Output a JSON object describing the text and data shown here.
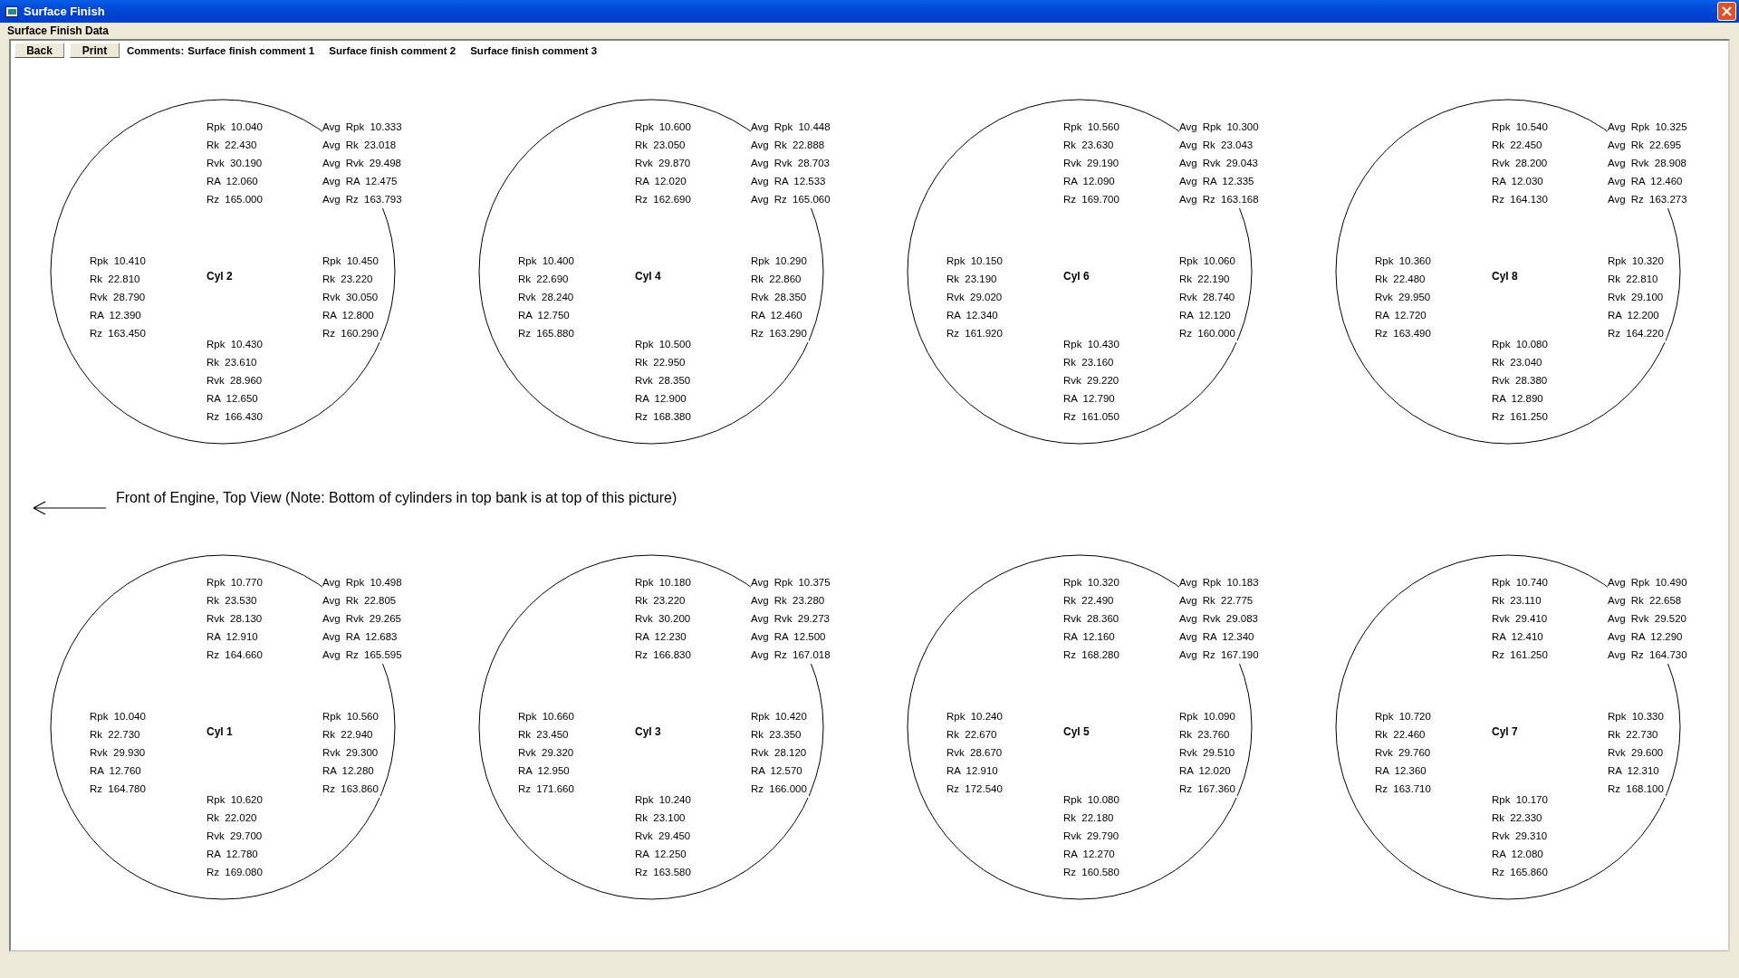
{
  "window": {
    "title": "Surface Finish"
  },
  "group_title": "Surface Finish Data",
  "buttons": [
    "Back",
    "Print"
  ],
  "comments_label": "Comments:",
  "comments": [
    "Surface finish comment 1",
    "Surface finish comment 2",
    "Surface finish comment 3"
  ],
  "note": "Front of Engine, Top View (Note: Bottom of cylinders in top bank is at top of this picture)",
  "top_bank": [
    {
      "label": "Cyl 2",
      "top": [
        "Rpk 10.040",
        "Rk 22.430",
        "Rvk 30.190",
        "RA 12.060",
        "Rz 165.000"
      ],
      "average": [
        "Avg Rpk 10.333",
        "Avg Rk 23.018",
        "Avg Rvk 29.498",
        "Avg RA 12.475",
        "Avg Rz 163.793"
      ],
      "left": [
        "Rpk 10.410",
        "Rk 22.810",
        "Rvk 28.790",
        "RA 12.390",
        "Rz 163.450"
      ],
      "right": [
        "Rpk 10.450",
        "Rk 23.220",
        "Rvk 30.050",
        "RA 12.800",
        "Rz 160.290"
      ],
      "bottom": [
        "Rpk 10.430",
        "Rk 23.610",
        "Rvk 28.960",
        "RA 12.650",
        "Rz 166.430"
      ]
    },
    {
      "label": "Cyl 4",
      "top": [
        "Rpk 10.600",
        "Rk 23.050",
        "Rvk 29.870",
        "RA 12.020",
        "Rz 162.690"
      ],
      "average": [
        "Avg Rpk 10.448",
        "Avg Rk 22.888",
        "Avg Rvk 28.703",
        "Avg RA 12.533",
        "Avg Rz 165.060"
      ],
      "left": [
        "Rpk 10.400",
        "Rk 22.690",
        "Rvk 28.240",
        "RA 12.750",
        "Rz 165.880"
      ],
      "right": [
        "Rpk 10.290",
        "Rk 22.860",
        "Rvk 28.350",
        "RA 12.460",
        "Rz 163.290"
      ],
      "bottom": [
        "Rpk 10.500",
        "Rk 22.950",
        "Rvk 28.350",
        "RA 12.900",
        "Rz 168.380"
      ]
    },
    {
      "label": "Cyl 6",
      "top": [
        "Rpk 10.560",
        "Rk 23.630",
        "Rvk 29.190",
        "RA 12.090",
        "Rz 169.700"
      ],
      "average": [
        "Avg Rpk 10.300",
        "Avg Rk 23.043",
        "Avg Rvk 29.043",
        "Avg RA 12.335",
        "Avg Rz 163.168"
      ],
      "left": [
        "Rpk 10.150",
        "Rk 23.190",
        "Rvk 29.020",
        "RA 12.340",
        "Rz 161.920"
      ],
      "right": [
        "Rpk 10.060",
        "Rk 22.190",
        "Rvk 28.740",
        "RA 12.120",
        "Rz 160.000"
      ],
      "bottom": [
        "Rpk 10.430",
        "Rk 23.160",
        "Rvk 29.220",
        "RA 12.790",
        "Rz 161.050"
      ]
    },
    {
      "label": "Cyl 8",
      "top": [
        "Rpk 10.540",
        "Rk 22.450",
        "Rvk 28.200",
        "RA 12.030",
        "Rz 164.130"
      ],
      "average": [
        "Avg Rpk 10.325",
        "Avg Rk 22.695",
        "Avg Rvk 28.908",
        "Avg RA 12.460",
        "Avg Rz 163.273"
      ],
      "left": [
        "Rpk 10.360",
        "Rk 22.480",
        "Rvk 29.950",
        "RA 12.720",
        "Rz 163.490"
      ],
      "right": [
        "Rpk 10.320",
        "Rk 22.810",
        "Rvk 29.100",
        "RA 12.200",
        "Rz 164.220"
      ],
      "bottom": [
        "Rpk 10.080",
        "Rk 23.040",
        "Rvk 28.380",
        "RA 12.890",
        "Rz 161.250"
      ]
    }
  ],
  "bottom_bank": [
    {
      "label": "Cyl 1",
      "top": [
        "Rpk 10.770",
        "Rk 23.530",
        "Rvk 28.130",
        "RA 12.910",
        "Rz 164.660"
      ],
      "average": [
        "Avg Rpk 10.498",
        "Avg Rk 22.805",
        "Avg Rvk 29.265",
        "Avg RA 12.683",
        "Avg Rz 165.595"
      ],
      "left": [
        "Rpk 10.040",
        "Rk 22.730",
        "Rvk 29.930",
        "RA 12.760",
        "Rz 164.780"
      ],
      "right": [
        "Rpk 10.560",
        "Rk 22.940",
        "Rvk 29.300",
        "RA 12.280",
        "Rz 163.860"
      ],
      "bottom": [
        "Rpk 10.620",
        "Rk 22.020",
        "Rvk 29.700",
        "RA 12.780",
        "Rz 169.080"
      ]
    },
    {
      "label": "Cyl 3",
      "top": [
        "Rpk 10.180",
        "Rk 23.220",
        "Rvk 30.200",
        "RA 12.230",
        "Rz 166.830"
      ],
      "average": [
        "Avg Rpk 10.375",
        "Avg Rk 23.280",
        "Avg Rvk 29.273",
        "Avg RA 12.500",
        "Avg Rz 167.018"
      ],
      "left": [
        "Rpk 10.660",
        "Rk 23.450",
        "Rvk 29.320",
        "RA 12.950",
        "Rz 171.660"
      ],
      "right": [
        "Rpk 10.420",
        "Rk 23.350",
        "Rvk 28.120",
        "RA 12.570",
        "Rz 166.000"
      ],
      "bottom": [
        "Rpk 10.240",
        "Rk 23.100",
        "Rvk 29.450",
        "RA 12.250",
        "Rz 163.580"
      ]
    },
    {
      "label": "Cyl 5",
      "top": [
        "Rpk 10.320",
        "Rk 22.490",
        "Rvk 28.360",
        "RA 12.160",
        "Rz 168.280"
      ],
      "average": [
        "Avg Rpk 10.183",
        "Avg Rk 22.775",
        "Avg Rvk 29.083",
        "Avg RA 12.340",
        "Avg Rz 167.190"
      ],
      "left": [
        "Rpk 10.240",
        "Rk 22.670",
        "Rvk 28.670",
        "RA 12.910",
        "Rz 172.540"
      ],
      "right": [
        "Rpk 10.090",
        "Rk 23.760",
        "Rvk 29.510",
        "RA 12.020",
        "Rz 167.360"
      ],
      "bottom": [
        "Rpk 10.080",
        "Rk 22.180",
        "Rvk 29.790",
        "RA 12.270",
        "Rz 160.580"
      ]
    },
    {
      "label": "Cyl 7",
      "top": [
        "Rpk 10.740",
        "Rk 23.110",
        "Rvk 29.410",
        "RA 12.410",
        "Rz 161.250"
      ],
      "average": [
        "Avg Rpk 10.490",
        "Avg Rk 22.658",
        "Avg Rvk 29.520",
        "Avg RA 12.290",
        "Avg Rz 164.730"
      ],
      "left": [
        "Rpk 10.720",
        "Rk 22.460",
        "Rvk 29.760",
        "RA 12.360",
        "Rz 163.710"
      ],
      "right": [
        "Rpk 10.330",
        "Rk 22.730",
        "Rvk 29.600",
        "RA 12.310",
        "Rz 168.100"
      ],
      "bottom": [
        "Rpk 10.170",
        "Rk 22.330",
        "Rvk 29.310",
        "RA 12.080",
        "Rz 165.860"
      ]
    }
  ]
}
